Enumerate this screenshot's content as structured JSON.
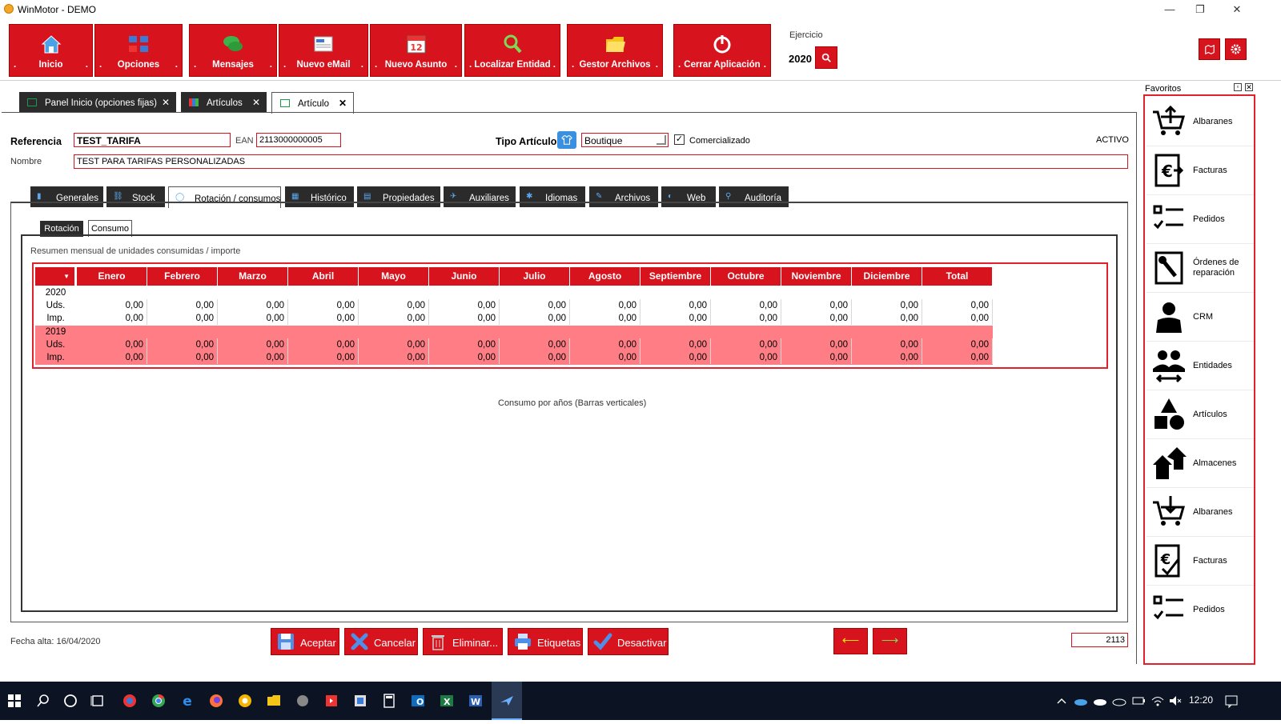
{
  "window": {
    "title": "WinMotor - DEMO",
    "controls": {
      "minimize": "—",
      "restore": "❐",
      "close": "✕"
    }
  },
  "toolbar": {
    "buttons": [
      {
        "label": "Inicio",
        "icon": "home-icon"
      },
      {
        "label": "Opciones",
        "icon": "options-icon"
      },
      {
        "label": "Mensajes",
        "icon": "messages-icon"
      },
      {
        "label": "Nuevo eMail",
        "icon": "new-email-icon"
      },
      {
        "label": "Nuevo Asunto",
        "icon": "calendar-icon"
      },
      {
        "label": "Localizar Entidad",
        "icon": "search-icon"
      },
      {
        "label": "Gestor Archivos",
        "icon": "folder-icon"
      },
      {
        "label": "Cerrar Aplicación",
        "icon": "power-icon"
      }
    ],
    "dot": ".",
    "ejercicio_label": "Ejercicio",
    "ejercicio_value": "2020"
  },
  "doc_tabs": [
    {
      "label": "Panel Inicio (opciones fijas)",
      "close": "✕"
    },
    {
      "label": "Artículos",
      "close": "✕"
    },
    {
      "label": "Artículo",
      "close": "✕"
    }
  ],
  "form": {
    "referencia_label": "Referencia",
    "referencia_value": "TEST_TARIFA",
    "ean_label": "EAN",
    "ean_value": "2113000000005",
    "tipo_label": "Tipo Artículo",
    "tipo_value": "Boutique",
    "comercializado_label": "Comercializado",
    "comercializado_checked": true,
    "status": "ACTIVO",
    "nombre_label": "Nombre",
    "nombre_value": "TEST PARA TARIFAS PERSONALIZADAS"
  },
  "sub_tabs": [
    "Generales",
    "Stock",
    "Rotación / consumos",
    "Histórico",
    "Propiedades",
    "Auxiliares",
    "Idiomas",
    "Archivos",
    "Web",
    "Auditoría"
  ],
  "inner_tabs": [
    "Rotación",
    "Consumo"
  ],
  "consumo": {
    "summary_label": "Resumen mensual de unidades consumidas / importe",
    "columns": [
      "Enero",
      "Febrero",
      "Marzo",
      "Abril",
      "Mayo",
      "Junio",
      "Julio",
      "Agosto",
      "Septiembre",
      "Octubre",
      "Noviembre",
      "Diciembre",
      "Total"
    ],
    "years": [
      {
        "year": "2020",
        "uds_label": "Uds.",
        "imp_label": "Imp.",
        "uds": [
          "0,00",
          "0,00",
          "0,00",
          "0,00",
          "0,00",
          "0,00",
          "0,00",
          "0,00",
          "0,00",
          "0,00",
          "0,00",
          "0,00",
          "0,00"
        ],
        "imp": [
          "0,00",
          "0,00",
          "0,00",
          "0,00",
          "0,00",
          "0,00",
          "0,00",
          "0,00",
          "0,00",
          "0,00",
          "0,00",
          "0,00",
          "0,00"
        ]
      },
      {
        "year": "2019",
        "uds_label": "Uds.",
        "imp_label": "Imp.",
        "uds": [
          "0,00",
          "0,00",
          "0,00",
          "0,00",
          "0,00",
          "0,00",
          "0,00",
          "0,00",
          "0,00",
          "0,00",
          "0,00",
          "0,00",
          "0,00"
        ],
        "imp": [
          "0,00",
          "0,00",
          "0,00",
          "0,00",
          "0,00",
          "0,00",
          "0,00",
          "0,00",
          "0,00",
          "0,00",
          "0,00",
          "0,00",
          "0,00"
        ]
      }
    ],
    "chart_caption": "Consumo por años (Barras verticales)"
  },
  "footer": {
    "fecha_alta": "Fecha alta: 16/04/2020",
    "buttons": [
      "Aceptar",
      "Cancelar",
      "Eliminar...",
      "Etiquetas",
      "Desactivar"
    ],
    "record_id": "2113"
  },
  "favoritos": {
    "title": "Favoritos",
    "items": [
      {
        "label": "Albaranes",
        "icon": "cart-upload-icon"
      },
      {
        "label": "Facturas",
        "icon": "invoice-euro-icon"
      },
      {
        "label": "Pedidos",
        "icon": "checklist-icon"
      },
      {
        "label": "Órdenes de reparación",
        "icon": "wrench-doc-icon"
      },
      {
        "label": "CRM",
        "icon": "person-icon"
      },
      {
        "label": "Entidades",
        "icon": "people-icon"
      },
      {
        "label": "Artículos",
        "icon": "shapes-icon"
      },
      {
        "label": "Almacenes",
        "icon": "warehouse-icon"
      },
      {
        "label": "Albaranes",
        "icon": "cart-download-icon"
      },
      {
        "label": "Facturas",
        "icon": "invoice-check-icon"
      },
      {
        "label": "Pedidos",
        "icon": "checklist-icon"
      }
    ]
  },
  "taskbar": {
    "time": "12:20"
  },
  "colors": {
    "accent": "#d7141e",
    "row_highlight": "#ff7e86",
    "taskbar": "#0c1424"
  }
}
